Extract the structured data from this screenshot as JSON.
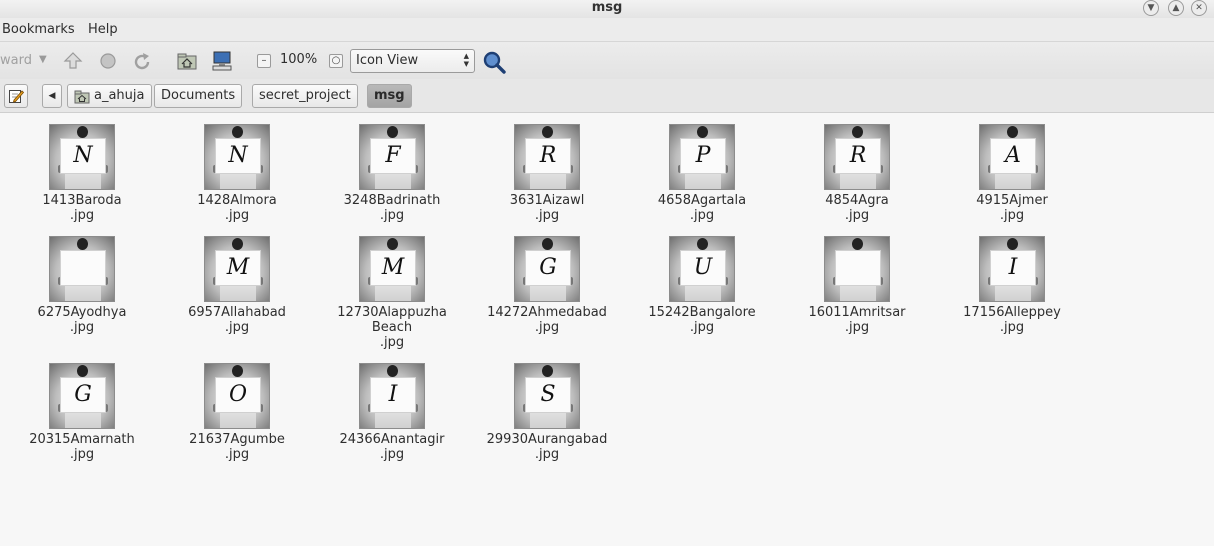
{
  "window": {
    "title": "msg"
  },
  "menubar": {
    "items": [
      "Bookmarks",
      "Help"
    ]
  },
  "toolbar": {
    "forward_label": "ward",
    "zoom_level": "100%",
    "view_mode": "Icon View"
  },
  "location": {
    "crumbs": [
      "a_ahuja",
      "Documents",
      "secret_project",
      "msg"
    ]
  },
  "files": [
    {
      "name": "1413Baroda\n.jpg",
      "letter": "N"
    },
    {
      "name": "1428Almora\n.jpg",
      "letter": "N"
    },
    {
      "name": "3248Badrinath\n.jpg",
      "letter": "F"
    },
    {
      "name": "3631Aizawl\n.jpg",
      "letter": "R"
    },
    {
      "name": "4658Agartala\n.jpg",
      "letter": "P"
    },
    {
      "name": "4854Agra\n.jpg",
      "letter": "R"
    },
    {
      "name": "4915Ajmer\n.jpg",
      "letter": "A"
    },
    {
      "name": "6275Ayodhya\n.jpg",
      "letter": ""
    },
    {
      "name": "6957Allahabad\n.jpg",
      "letter": "M"
    },
    {
      "name": "12730Alappuzha\nBeach\n.jpg",
      "letter": "M"
    },
    {
      "name": "14272Ahmedabad\n.jpg",
      "letter": "G"
    },
    {
      "name": "15242Bangalore\n.jpg",
      "letter": "U"
    },
    {
      "name": "16011Amritsar\n.jpg",
      "letter": ""
    },
    {
      "name": "17156Alleppey\n.jpg",
      "letter": "I"
    },
    {
      "name": "20315Amarnath\n.jpg",
      "letter": "G"
    },
    {
      "name": "21637Agumbe\n.jpg",
      "letter": "O"
    },
    {
      "name": "24366Anantagir\n.jpg",
      "letter": "I"
    },
    {
      "name": "29930Aurangabad\n.jpg",
      "letter": "S"
    }
  ]
}
